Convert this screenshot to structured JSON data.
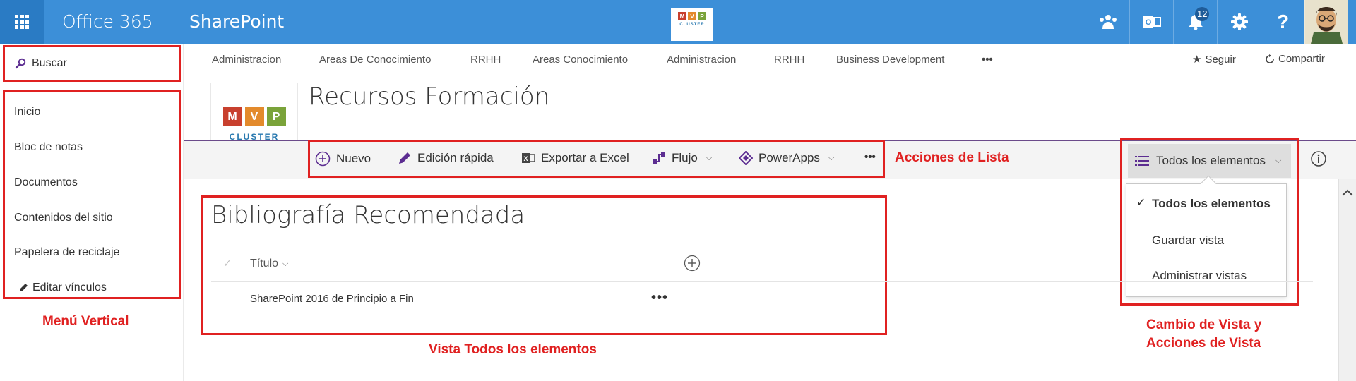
{
  "suite": {
    "brand": "Office 365",
    "app": "SharePoint",
    "notifications_count": "12",
    "help_glyph": "?",
    "logo_letters": [
      "M",
      "V",
      "P"
    ],
    "logo_word": "CLUSTER",
    "icons": [
      "app-launcher-icon",
      "yammer-icon",
      "outlook-icon",
      "bell-icon",
      "gear-icon",
      "help-icon",
      "avatar"
    ]
  },
  "search": {
    "label": "Buscar"
  },
  "leftnav": {
    "items": [
      "Inicio",
      "Bloc de notas",
      "Documentos",
      "Contenidos del sitio",
      "Papelera de reciclaje"
    ],
    "edit_links": "Editar vínculos"
  },
  "topnav": {
    "items": [
      "Administracion",
      "Areas De Conocimiento",
      "RRHH",
      "Areas Conocimiento",
      "Administracion",
      "RRHH",
      "Business Development"
    ],
    "more": "•••",
    "follow": "Seguir",
    "share": "Compartir"
  },
  "site": {
    "title": "Recursos Formación",
    "logo_letters": [
      "M",
      "V",
      "P"
    ],
    "logo_word": "CLUSTER"
  },
  "commands": {
    "new": "Nuevo",
    "quick_edit": "Edición rápida",
    "export_excel": "Exportar a Excel",
    "flow": "Flujo",
    "powerapps": "PowerApps",
    "more": "•••"
  },
  "view": {
    "current": "Todos los elementos",
    "menu": {
      "selected": "Todos los elementos",
      "save": "Guardar vista",
      "manage": "Administrar vistas"
    }
  },
  "list": {
    "title": "Bibliografía Recomendada",
    "column_title": "Título",
    "rows": [
      {
        "title": "SharePoint 2016 de Principio a Fin"
      }
    ]
  },
  "annotations": {
    "list_actions": "Acciones de Lista",
    "vertical_menu": "Menú Vertical",
    "all_items_view": "Vista Todos los elementos",
    "view_change_line1": "Cambio de Vista y",
    "view_change_line2": "Acciones de Vista"
  },
  "colors": {
    "suite_bar": "#3c8fd8",
    "waffle": "#2a7bc4",
    "annotation_red": "#e02121",
    "command_icons": "#5c2d91",
    "logo_red": "#c8402e",
    "logo_orange": "#e38a2c",
    "logo_green": "#7aa33a",
    "logo_blue": "#2a7ab0"
  }
}
